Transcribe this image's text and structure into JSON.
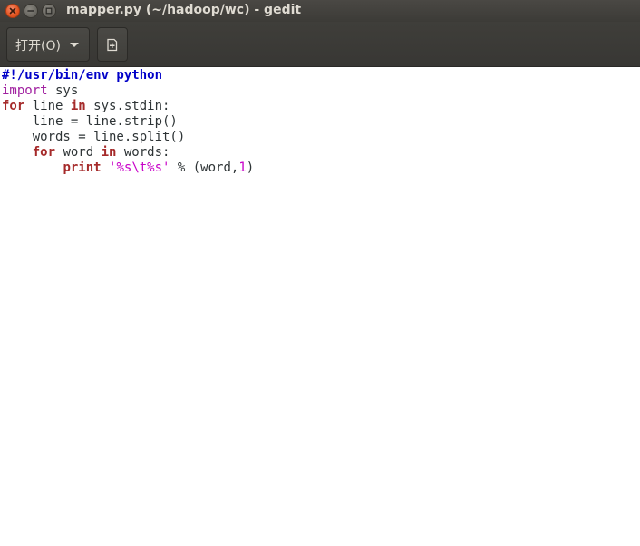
{
  "window": {
    "title": "mapper.py (~/hadoop/wc) - gedit"
  },
  "toolbar": {
    "open_label": "打开(O)",
    "icons": {
      "open_dropdown": "chevron-down-icon",
      "new_document": "new-document-icon"
    }
  },
  "colors": {
    "titlebar_bg": "#3c3b37",
    "title_text": "#dfdbd2",
    "close_button": "#e3541f",
    "shebang": "#0000c8",
    "import_keyword": "#a020a0",
    "keyword": "#a52a2a",
    "string": "#c800c8",
    "number": "#c800c8",
    "text": "#2e3436"
  },
  "code": {
    "line1": {
      "shebang": "#!/usr/bin/env python"
    },
    "line2": {
      "kw": "import",
      "rest": " sys"
    },
    "line3": {
      "kw1": "for",
      "t1": " line ",
      "kw2": "in",
      "t2": " sys.stdin:"
    },
    "line4": {
      "indent": "    ",
      "text": "line = line.strip()"
    },
    "line5": {
      "indent": "    ",
      "text": "words = line.split()"
    },
    "line6": {
      "indent": "    ",
      "kw1": "for",
      "t1": " word ",
      "kw2": "in",
      "t2": " words:"
    },
    "line7": {
      "indent": "        ",
      "kw": "print",
      "t1": " ",
      "str": "'%s\\t%s'",
      "t2": " % (word,",
      "num": "1",
      "t3": ")"
    }
  }
}
